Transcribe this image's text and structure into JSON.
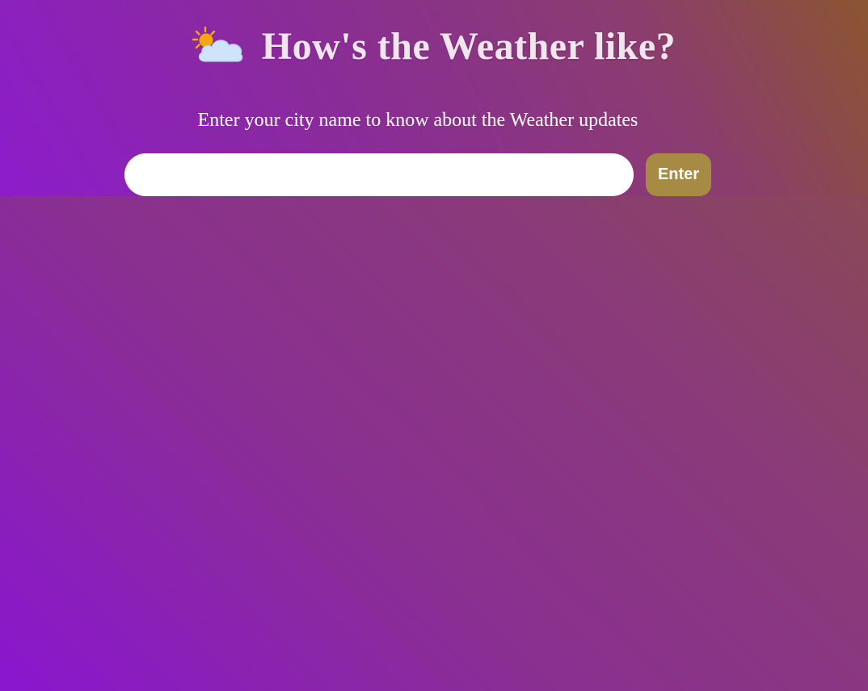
{
  "header": {
    "icon": "sun-behind-cloud-icon",
    "title": "How's the Weather like?",
    "subtitle": "Enter your city name to know about the Weather updates"
  },
  "search": {
    "value": "",
    "placeholder": "",
    "button_label": "Enter"
  },
  "colors": {
    "button": "#a78a44",
    "title": "#f2e6ee",
    "background_start": "#8a16cf",
    "background_end": "#8a5a2e"
  }
}
